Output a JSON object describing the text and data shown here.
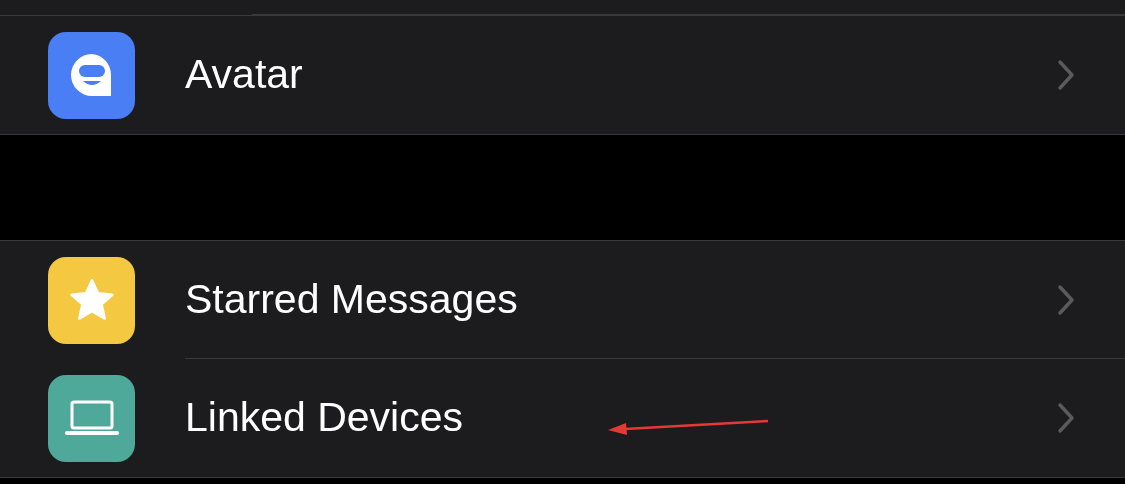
{
  "sections": [
    {
      "rows": [
        {
          "label": "Avatar",
          "kind": "avatar"
        }
      ]
    },
    {
      "rows": [
        {
          "label": "Starred Messages",
          "kind": "star"
        },
        {
          "label": "Linked Devices",
          "kind": "laptop"
        }
      ]
    }
  ]
}
